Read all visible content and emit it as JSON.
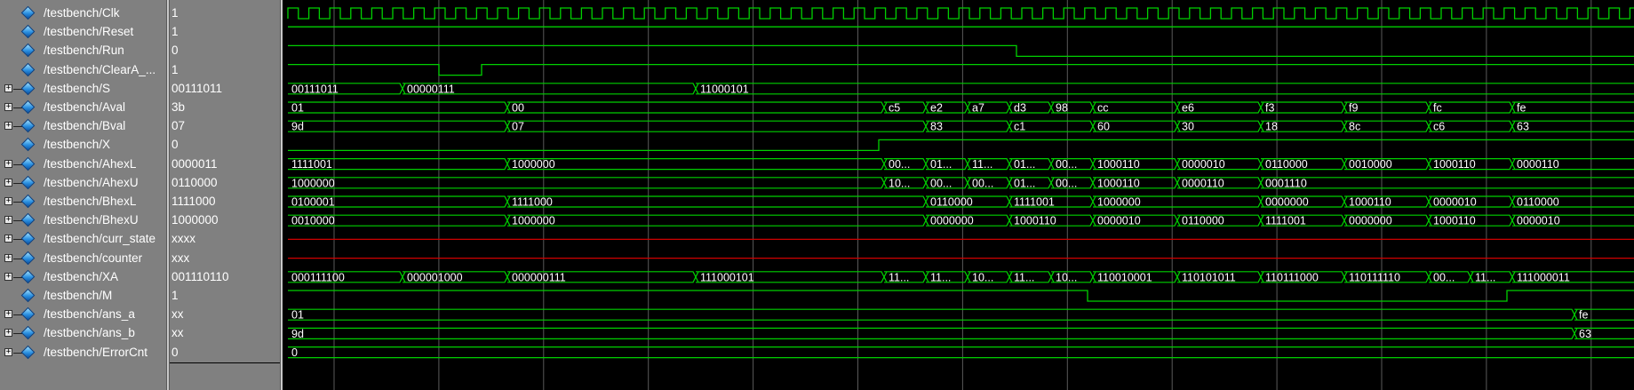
{
  "colors": {
    "wave": "#00d000",
    "unknown": "#d00000",
    "grid": "#5a5a5a",
    "text": "#ffffff"
  },
  "signals": [
    {
      "name": "/testbench/Clk",
      "value": "1",
      "expandable": false,
      "icon": "signal-diamond-icon"
    },
    {
      "name": "/testbench/Reset",
      "value": "1",
      "expandable": false,
      "icon": "signal-diamond-icon"
    },
    {
      "name": "/testbench/Run",
      "value": "0",
      "expandable": false,
      "icon": "signal-diamond-icon"
    },
    {
      "name": "/testbench/ClearA_...",
      "value": "1",
      "expandable": false,
      "icon": "signal-diamond-icon"
    },
    {
      "name": "/testbench/S",
      "value": "00111011",
      "expandable": true,
      "icon": "signal-diamond-icon"
    },
    {
      "name": "/testbench/Aval",
      "value": "3b",
      "expandable": true,
      "icon": "signal-diamond-icon"
    },
    {
      "name": "/testbench/Bval",
      "value": "07",
      "expandable": true,
      "icon": "signal-diamond-icon"
    },
    {
      "name": "/testbench/X",
      "value": "0",
      "expandable": false,
      "icon": "signal-diamond-icon"
    },
    {
      "name": "/testbench/AhexL",
      "value": "0000011",
      "expandable": true,
      "icon": "signal-diamond-icon"
    },
    {
      "name": "/testbench/AhexU",
      "value": "0110000",
      "expandable": true,
      "icon": "signal-diamond-icon"
    },
    {
      "name": "/testbench/BhexL",
      "value": "1111000",
      "expandable": true,
      "icon": "signal-diamond-icon"
    },
    {
      "name": "/testbench/BhexU",
      "value": "1000000",
      "expandable": true,
      "icon": "signal-diamond-icon"
    },
    {
      "name": "/testbench/curr_state",
      "value": "xxxx",
      "expandable": true,
      "icon": "signal-diamond-icon"
    },
    {
      "name": "/testbench/counter",
      "value": "xxx",
      "expandable": true,
      "icon": "signal-diamond-icon"
    },
    {
      "name": "/testbench/XA",
      "value": "001110110",
      "expandable": true,
      "icon": "signal-diamond-icon"
    },
    {
      "name": "/testbench/M",
      "value": "1",
      "expandable": false,
      "icon": "signal-diamond-icon"
    },
    {
      "name": "/testbench/ans_a",
      "value": "xx",
      "expandable": true,
      "icon": "signal-diamond-icon"
    },
    {
      "name": "/testbench/ans_b",
      "value": "xx",
      "expandable": true,
      "icon": "signal-diamond-icon"
    },
    {
      "name": "/testbench/ErrorCnt",
      "value": "0",
      "expandable": true,
      "icon": "signal-diamond-icon"
    }
  ],
  "waves": [
    {
      "kind": "clock"
    },
    {
      "kind": "bit",
      "init": 1,
      "edges": []
    },
    {
      "kind": "bit",
      "init": 1,
      "edges": [
        [
          826,
          0
        ],
        [
          1767,
          1
        ]
      ]
    },
    {
      "kind": "bit",
      "init": 1,
      "edges": [
        [
          176,
          0
        ],
        [
          224,
          1
        ]
      ]
    },
    {
      "kind": "bus",
      "segs": [
        [
          0,
          "00111011"
        ],
        [
          129,
          "00000111"
        ],
        [
          459,
          "11000101"
        ]
      ]
    },
    {
      "kind": "bus",
      "segs": [
        [
          0,
          "01"
        ],
        [
          247,
          "00"
        ],
        [
          671,
          "c5"
        ],
        [
          718,
          "e2"
        ],
        [
          765,
          "a7"
        ],
        [
          812,
          "d3"
        ],
        [
          859,
          "98"
        ],
        [
          906,
          "cc"
        ],
        [
          1001,
          "e6"
        ],
        [
          1095,
          "f3"
        ],
        [
          1189,
          "f9"
        ],
        [
          1284,
          "fc"
        ],
        [
          1378,
          "fe"
        ]
      ]
    },
    {
      "kind": "bus",
      "segs": [
        [
          0,
          "9d"
        ],
        [
          247,
          "07"
        ],
        [
          718,
          "83"
        ],
        [
          812,
          "c1"
        ],
        [
          906,
          "60"
        ],
        [
          1001,
          "30"
        ],
        [
          1095,
          "18"
        ],
        [
          1189,
          "8c"
        ],
        [
          1284,
          "c6"
        ],
        [
          1378,
          "63"
        ]
      ]
    },
    {
      "kind": "bit",
      "init": 0,
      "edges": [
        [
          671,
          1
        ]
      ]
    },
    {
      "kind": "bus",
      "segs": [
        [
          0,
          "1111001"
        ],
        [
          247,
          "1000000"
        ],
        [
          671,
          "00..."
        ],
        [
          718,
          "01..."
        ],
        [
          765,
          "11..."
        ],
        [
          812,
          "01..."
        ],
        [
          859,
          "00..."
        ],
        [
          906,
          "1000110"
        ],
        [
          1001,
          "0000010"
        ],
        [
          1095,
          "0110000"
        ],
        [
          1189,
          "0010000"
        ],
        [
          1284,
          "1000110"
        ],
        [
          1378,
          "0000110"
        ]
      ]
    },
    {
      "kind": "bus",
      "segs": [
        [
          0,
          "1000000"
        ],
        [
          671,
          "10..."
        ],
        [
          718,
          "00..."
        ],
        [
          765,
          "00..."
        ],
        [
          812,
          "01..."
        ],
        [
          859,
          "00..."
        ],
        [
          906,
          "1000110"
        ],
        [
          1001,
          "0000110"
        ],
        [
          1095,
          "0001110"
        ]
      ]
    },
    {
      "kind": "bus",
      "segs": [
        [
          0,
          "0100001"
        ],
        [
          247,
          "1111000"
        ],
        [
          718,
          "0110000"
        ],
        [
          812,
          "1111001"
        ],
        [
          906,
          "1000000"
        ],
        [
          1095,
          "0000000"
        ],
        [
          1189,
          "1000110"
        ],
        [
          1284,
          "0000010"
        ],
        [
          1378,
          "0110000"
        ]
      ]
    },
    {
      "kind": "bus",
      "segs": [
        [
          0,
          "0010000"
        ],
        [
          247,
          "1000000"
        ],
        [
          718,
          "0000000"
        ],
        [
          812,
          "1000110"
        ],
        [
          906,
          "0000010"
        ],
        [
          1001,
          "0110000"
        ],
        [
          1095,
          "1111001"
        ],
        [
          1189,
          "0000000"
        ],
        [
          1284,
          "1000110"
        ],
        [
          1378,
          "0000010"
        ]
      ]
    },
    {
      "kind": "unknown"
    },
    {
      "kind": "unknown"
    },
    {
      "kind": "bus",
      "segs": [
        [
          0,
          "000111100"
        ],
        [
          129,
          "000001000"
        ],
        [
          247,
          "000000111"
        ],
        [
          459,
          "111000101"
        ],
        [
          671,
          "11..."
        ],
        [
          718,
          "11..."
        ],
        [
          765,
          "10..."
        ],
        [
          812,
          "11..."
        ],
        [
          859,
          "10..."
        ],
        [
          906,
          "110010001"
        ],
        [
          1001,
          "110101011"
        ],
        [
          1095,
          "110111000"
        ],
        [
          1189,
          "110111110"
        ],
        [
          1284,
          "00..."
        ],
        [
          1331,
          "11..."
        ],
        [
          1378,
          "111000011"
        ]
      ]
    },
    {
      "kind": "bit",
      "init": 1,
      "edges": [
        [
          906,
          0
        ],
        [
          1378,
          1
        ]
      ]
    },
    {
      "kind": "bus",
      "segs": [
        [
          0,
          "01"
        ],
        [
          1448,
          "fe"
        ]
      ]
    },
    {
      "kind": "bus",
      "segs": [
        [
          0,
          "9d"
        ],
        [
          1448,
          "63"
        ]
      ]
    },
    {
      "kind": "bus",
      "segs": [
        [
          0,
          "0"
        ]
      ]
    }
  ]
}
